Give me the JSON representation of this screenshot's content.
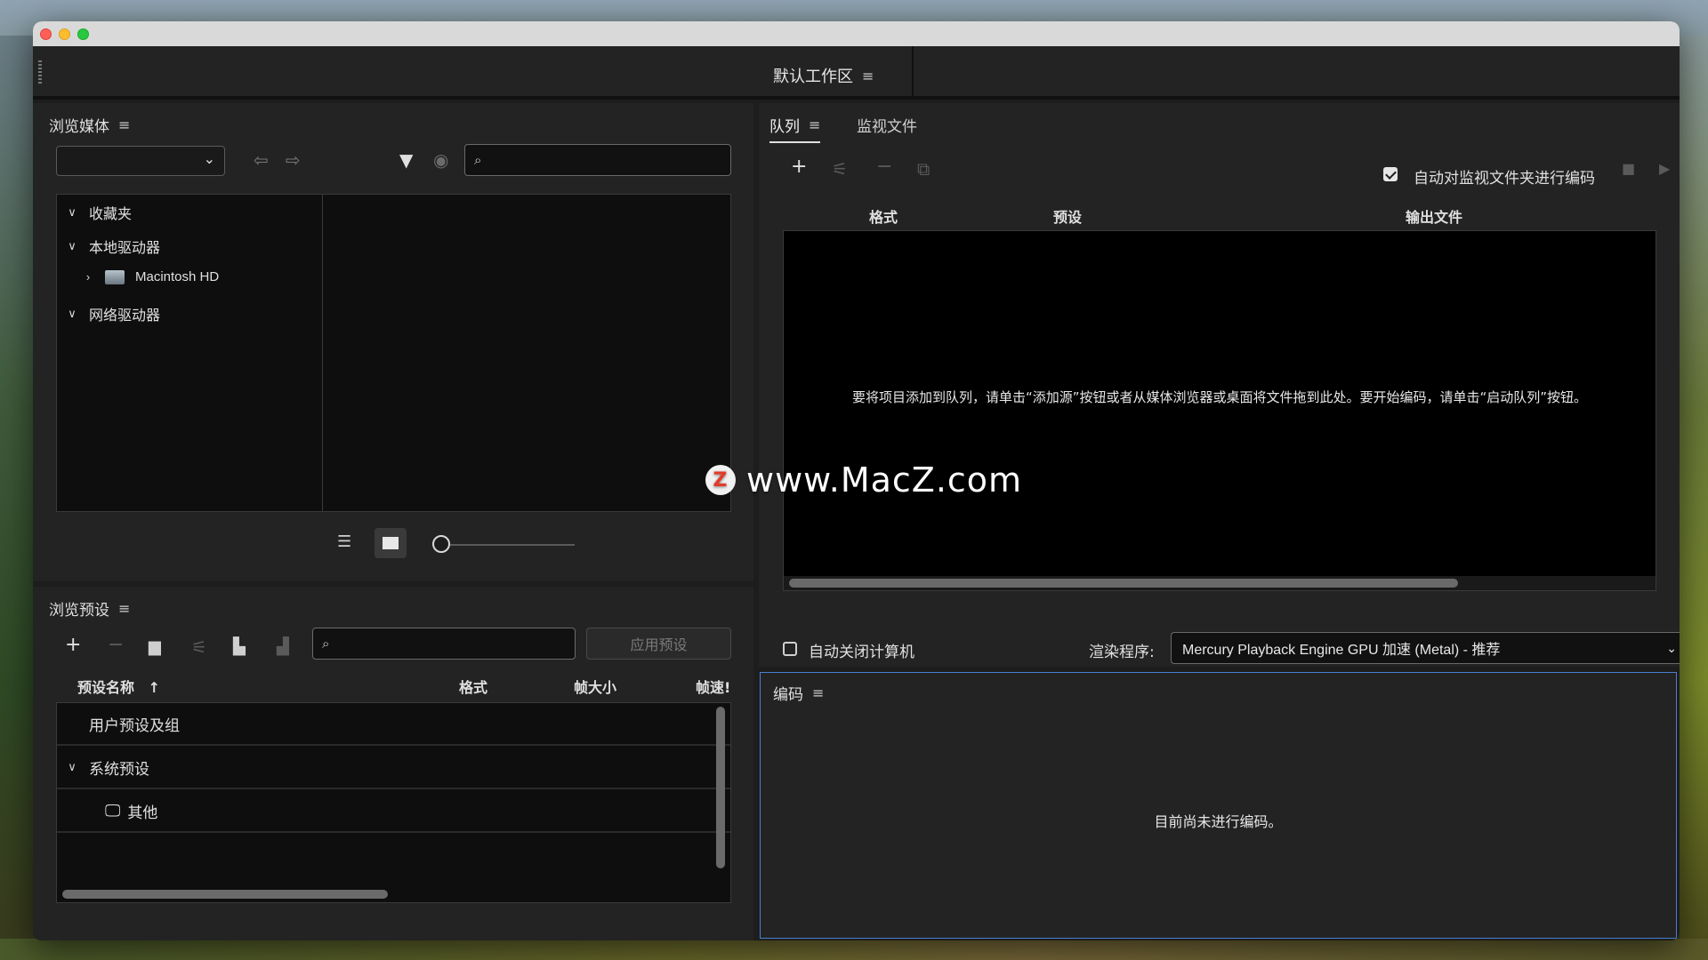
{
  "workspace": {
    "title": "默认工作区"
  },
  "media_browser": {
    "title": "浏览媒体",
    "location_value": "",
    "search_placeholder": "",
    "tree": [
      {
        "label": "收藏夹",
        "expanded": true
      },
      {
        "label": "本地驱动器",
        "expanded": true
      },
      {
        "label": "Macintosh HD",
        "expanded": false
      },
      {
        "label": "网络驱动器",
        "expanded": true
      }
    ]
  },
  "queue": {
    "tabs": [
      {
        "label": "队列",
        "active": true
      },
      {
        "label": "监视文件",
        "active": false
      }
    ],
    "auto_encode_label": "自动对监视文件夹进行编码",
    "auto_encode_checked": true,
    "columns": {
      "format": "格式",
      "preset": "预设",
      "output": "输出文件"
    },
    "empty_message": "要将项目添加到队列，请单击“添加源”按钮或者从媒体浏览器或桌面将文件拖到此处。要开始编码，请单击“启动队列”按钮。",
    "auto_shutdown_label": "自动关闭计算机",
    "auto_shutdown_checked": false,
    "renderer_label": "渲染程序:",
    "renderer_value": "Mercury Playback Engine GPU 加速 (Metal) - 推荐"
  },
  "preset_browser": {
    "title": "浏览预设",
    "search_placeholder": "",
    "apply_label": "应用预设",
    "columns": {
      "name": "预设名称",
      "format": "格式",
      "frame_size": "帧大小",
      "frame_rate": "帧速!"
    },
    "rows": [
      {
        "label": "用户预设及组"
      },
      {
        "label": "系统预设"
      },
      {
        "label": "其他"
      }
    ]
  },
  "encoding": {
    "title": "编码",
    "status": "目前尚未进行编码。"
  },
  "watermark": {
    "text": "www.MacZ.com",
    "logo": "Z"
  }
}
